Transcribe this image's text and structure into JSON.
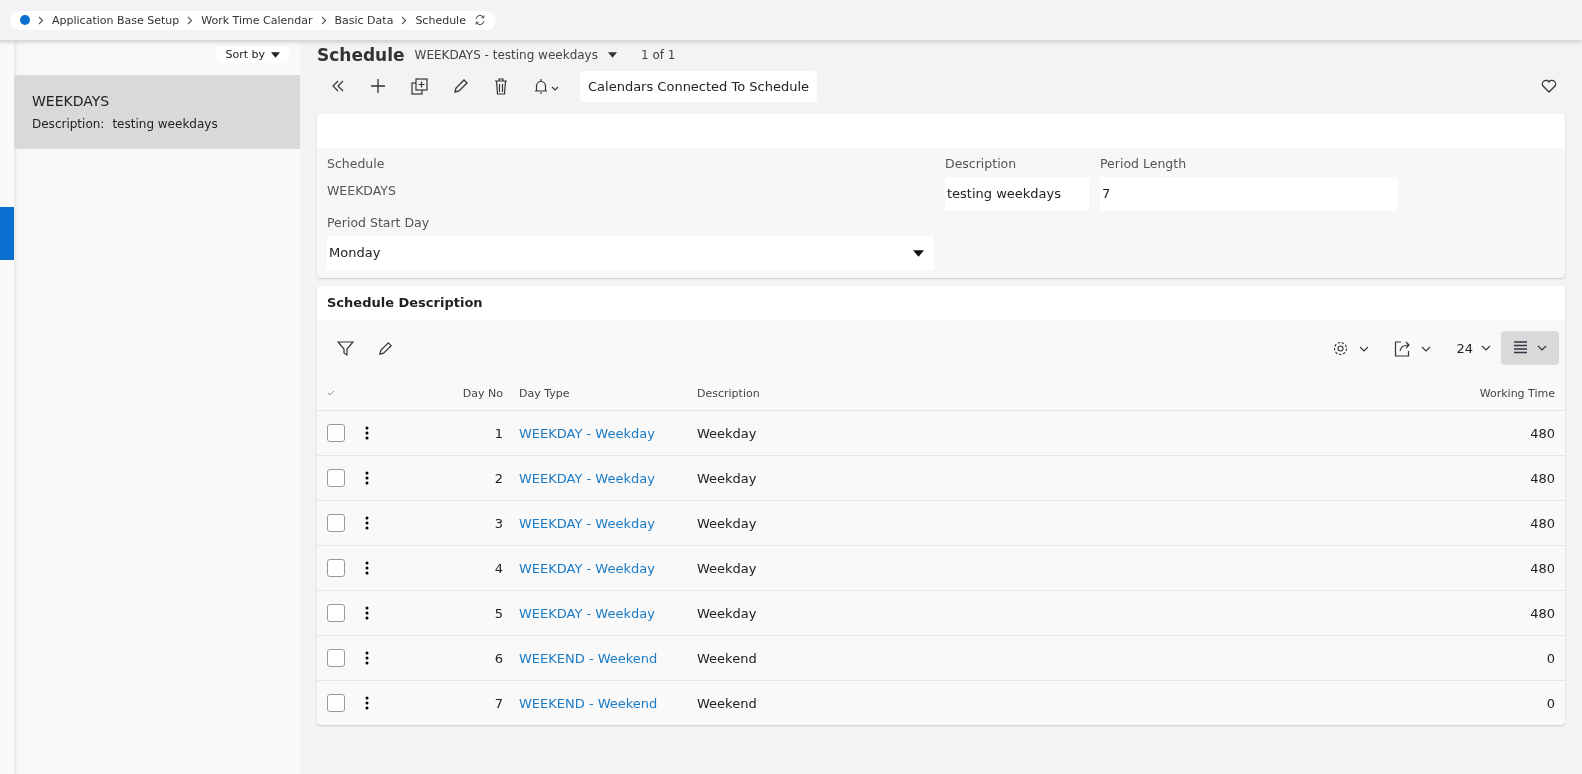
{
  "breadcrumb": {
    "items": [
      "Application Base Setup",
      "Work Time Calendar",
      "Basic Data",
      "Schedule"
    ]
  },
  "header": {
    "title": "Schedule",
    "record": "WEEKDAYS - testing weekdays",
    "count": "1 of 1"
  },
  "sidebar": {
    "sort_label": "Sort by",
    "items": [
      {
        "title": "WEEKDAYS",
        "description_label": "Description:",
        "description": "testing weekdays",
        "selected": true
      }
    ]
  },
  "toolbar": {
    "command": "Calendars Connected To Schedule"
  },
  "form": {
    "fields": [
      {
        "label": "Schedule",
        "value": "WEEKDAYS",
        "kind": "readonly"
      },
      {
        "label": "Description",
        "value": "testing weekdays",
        "kind": "text"
      },
      {
        "label": "Period Length",
        "value": "7",
        "kind": "text"
      },
      {
        "label": "Period Start Day",
        "value": "Monday",
        "kind": "select"
      }
    ]
  },
  "table": {
    "title": "Schedule Description",
    "page_size": "24",
    "columns": [
      "Day No",
      "Day Type",
      "Description",
      "Working Time"
    ],
    "rows": [
      {
        "day_no": "1",
        "day_type": "WEEKDAY - Weekday",
        "description": "Weekday",
        "working_time": "480",
        "selected": false
      },
      {
        "day_no": "2",
        "day_type": "WEEKDAY - Weekday",
        "description": "Weekday",
        "working_time": "480",
        "selected": false
      },
      {
        "day_no": "3",
        "day_type": "WEEKDAY - Weekday",
        "description": "Weekday",
        "working_time": "480",
        "selected": false
      },
      {
        "day_no": "4",
        "day_type": "WEEKDAY - Weekday",
        "description": "Weekday",
        "working_time": "480",
        "selected": false
      },
      {
        "day_no": "5",
        "day_type": "WEEKDAY - Weekday",
        "description": "Weekday",
        "working_time": "480",
        "selected": false
      },
      {
        "day_no": "6",
        "day_type": "WEEKEND - Weekend",
        "description": "Weekend",
        "working_time": "0",
        "selected": false
      },
      {
        "day_no": "7",
        "day_type": "WEEKEND - Weekend",
        "description": "Weekend",
        "working_time": "0",
        "selected": false
      }
    ]
  }
}
